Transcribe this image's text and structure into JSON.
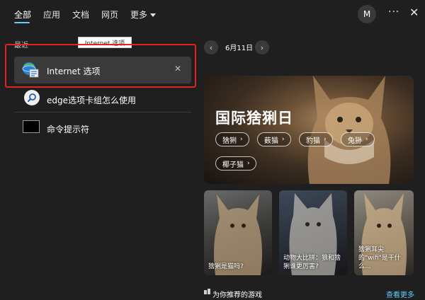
{
  "nav": {
    "tabs": [
      "全部",
      "应用",
      "文档",
      "网页",
      "更多"
    ],
    "avatar_letter": "M",
    "more_glyph": "···",
    "close_glyph": "✕"
  },
  "left": {
    "recent_label": "最近",
    "tooltip": "Internet 选项",
    "results": [
      {
        "label": "Internet 选项",
        "icon": "internet-options-icon",
        "remove": "✕"
      },
      {
        "label": "edge选项卡组怎么使用",
        "icon": "web-search-icon"
      },
      {
        "label": "命令提示符",
        "icon": "command-prompt-icon"
      }
    ]
  },
  "right": {
    "date": "6月11日",
    "prev_glyph": "‹",
    "next_glyph": "›",
    "hero": {
      "title": "国际猞猁日",
      "pills": [
        "猞猁",
        "薮猫",
        "豹猫",
        "兔狲",
        "椰子猫"
      ],
      "pill_arrow": "›"
    },
    "cards": [
      {
        "caption": "猞猁是猫吗?"
      },
      {
        "caption": "动物大比拼：狼和猞猁谁更厉害?"
      },
      {
        "caption": "猞猁耳尖的\"wifi\"是干什么..."
      }
    ],
    "games": {
      "label": "为你推荐的游戏",
      "link": "查看更多"
    }
  },
  "colors": {
    "accent": "#60cdff",
    "highlight": "#e5231e",
    "background": "#1f1f1f"
  }
}
